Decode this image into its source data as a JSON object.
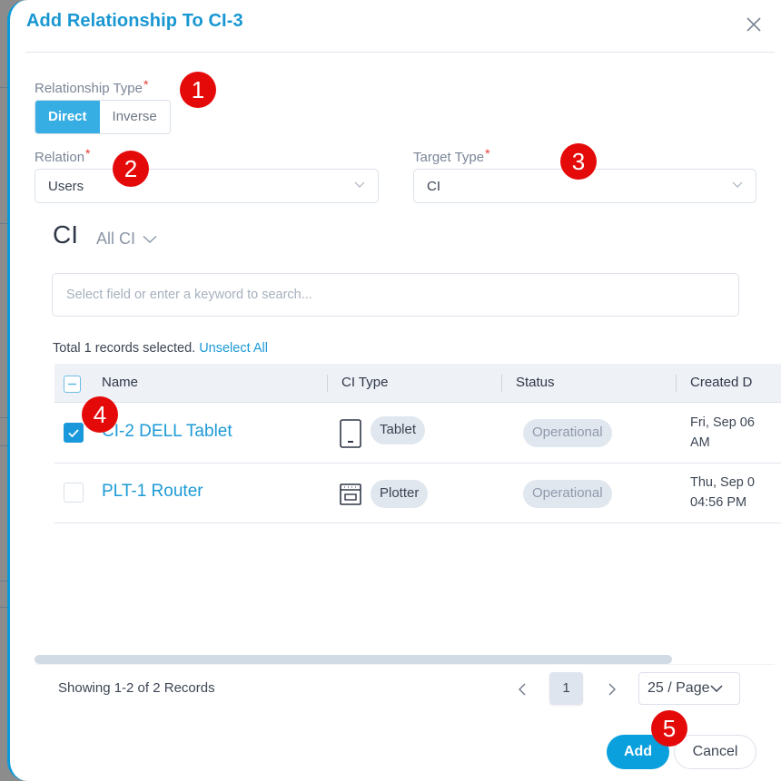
{
  "dialog": {
    "title": "Add Relationship To CI-3",
    "close_icon": "close-icon"
  },
  "relationship_type": {
    "label": "Relationship Type",
    "required_mark": "*",
    "options": [
      "Direct",
      "Inverse"
    ],
    "selected": "Direct"
  },
  "relation": {
    "label": "Relation",
    "required_mark": "*",
    "value": "Users"
  },
  "target_type": {
    "label": "Target Type",
    "required_mark": "*",
    "value": "CI"
  },
  "ci_section": {
    "title": "CI",
    "filter_label": "All CI"
  },
  "search": {
    "placeholder": "Select field or enter a keyword to search..."
  },
  "selection": {
    "text": "Total 1 records selected.",
    "unselect_label": "Unselect All"
  },
  "table": {
    "columns": [
      "Name",
      "CI Type",
      "Status",
      "Created D"
    ],
    "rows": [
      {
        "checked": true,
        "name": "CI-2 DELL Tablet",
        "ci_type": "Tablet",
        "ci_type_icon": "tablet-icon",
        "status": "Operational",
        "created_line1": "Fri, Sep 06",
        "created_line2": "AM"
      },
      {
        "checked": false,
        "name": "PLT-1 Router",
        "ci_type": "Plotter",
        "ci_type_icon": "plotter-icon",
        "status": "Operational",
        "created_line1": "Thu, Sep 0",
        "created_line2": "04:56 PM"
      }
    ]
  },
  "pagination": {
    "summary": "Showing 1-2 of 2 Records",
    "current_page": "1",
    "page_size": "25 / Page"
  },
  "actions": {
    "add_label": "Add",
    "cancel_label": "Cancel"
  },
  "annotations": [
    "1",
    "2",
    "3",
    "4",
    "5"
  ],
  "colors": {
    "accent": "#0aa0dd",
    "title": "#1897d2",
    "annotation_badge": "#e50a0a",
    "required": "#e53935"
  }
}
